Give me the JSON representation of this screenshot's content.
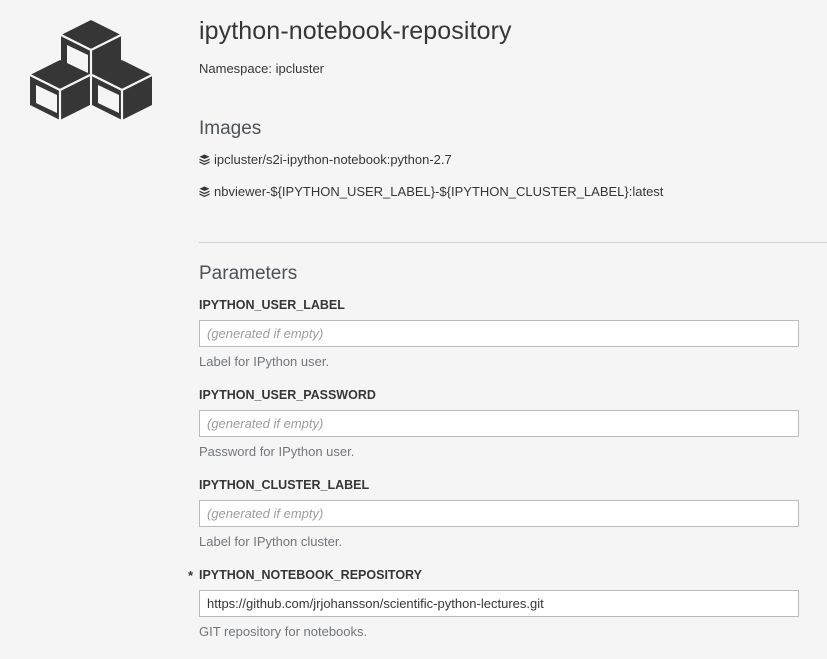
{
  "template": {
    "title": "ipython-notebook-repository",
    "namespace": "Namespace: ipcluster"
  },
  "images": {
    "heading": "Images",
    "items": [
      {
        "name": "ipcluster/s2i-ipython-notebook:python-2.7",
        "icon": "cubes-icon"
      },
      {
        "name": "nbviewer-${IPYTHON_USER_LABEL}-${IPYTHON_CLUSTER_LABEL}:latest",
        "icon": "cubes-icon"
      }
    ]
  },
  "parameters": {
    "heading": "Parameters",
    "items": [
      {
        "label": "IPYTHON_USER_LABEL",
        "required": false,
        "value": "",
        "placeholder": "(generated if empty)",
        "help": "Label for IPython user."
      },
      {
        "label": "IPYTHON_USER_PASSWORD",
        "required": false,
        "value": "",
        "placeholder": "(generated if empty)",
        "help": "Password for IPython user."
      },
      {
        "label": "IPYTHON_CLUSTER_LABEL",
        "required": false,
        "value": "",
        "placeholder": "(generated if empty)",
        "help": "Label for IPython cluster."
      },
      {
        "label": "IPYTHON_NOTEBOOK_REPOSITORY",
        "required": true,
        "required_mark": "*",
        "value": "https://github.com/jrjohansson/scientific-python-lectures.git",
        "placeholder": "",
        "help": "GIT repository for notebooks."
      }
    ]
  },
  "colors": {
    "background": "#f5f5f5",
    "logo": "#363636",
    "text": "#363636",
    "help_text": "#72767b",
    "input_border": "#bababa"
  }
}
